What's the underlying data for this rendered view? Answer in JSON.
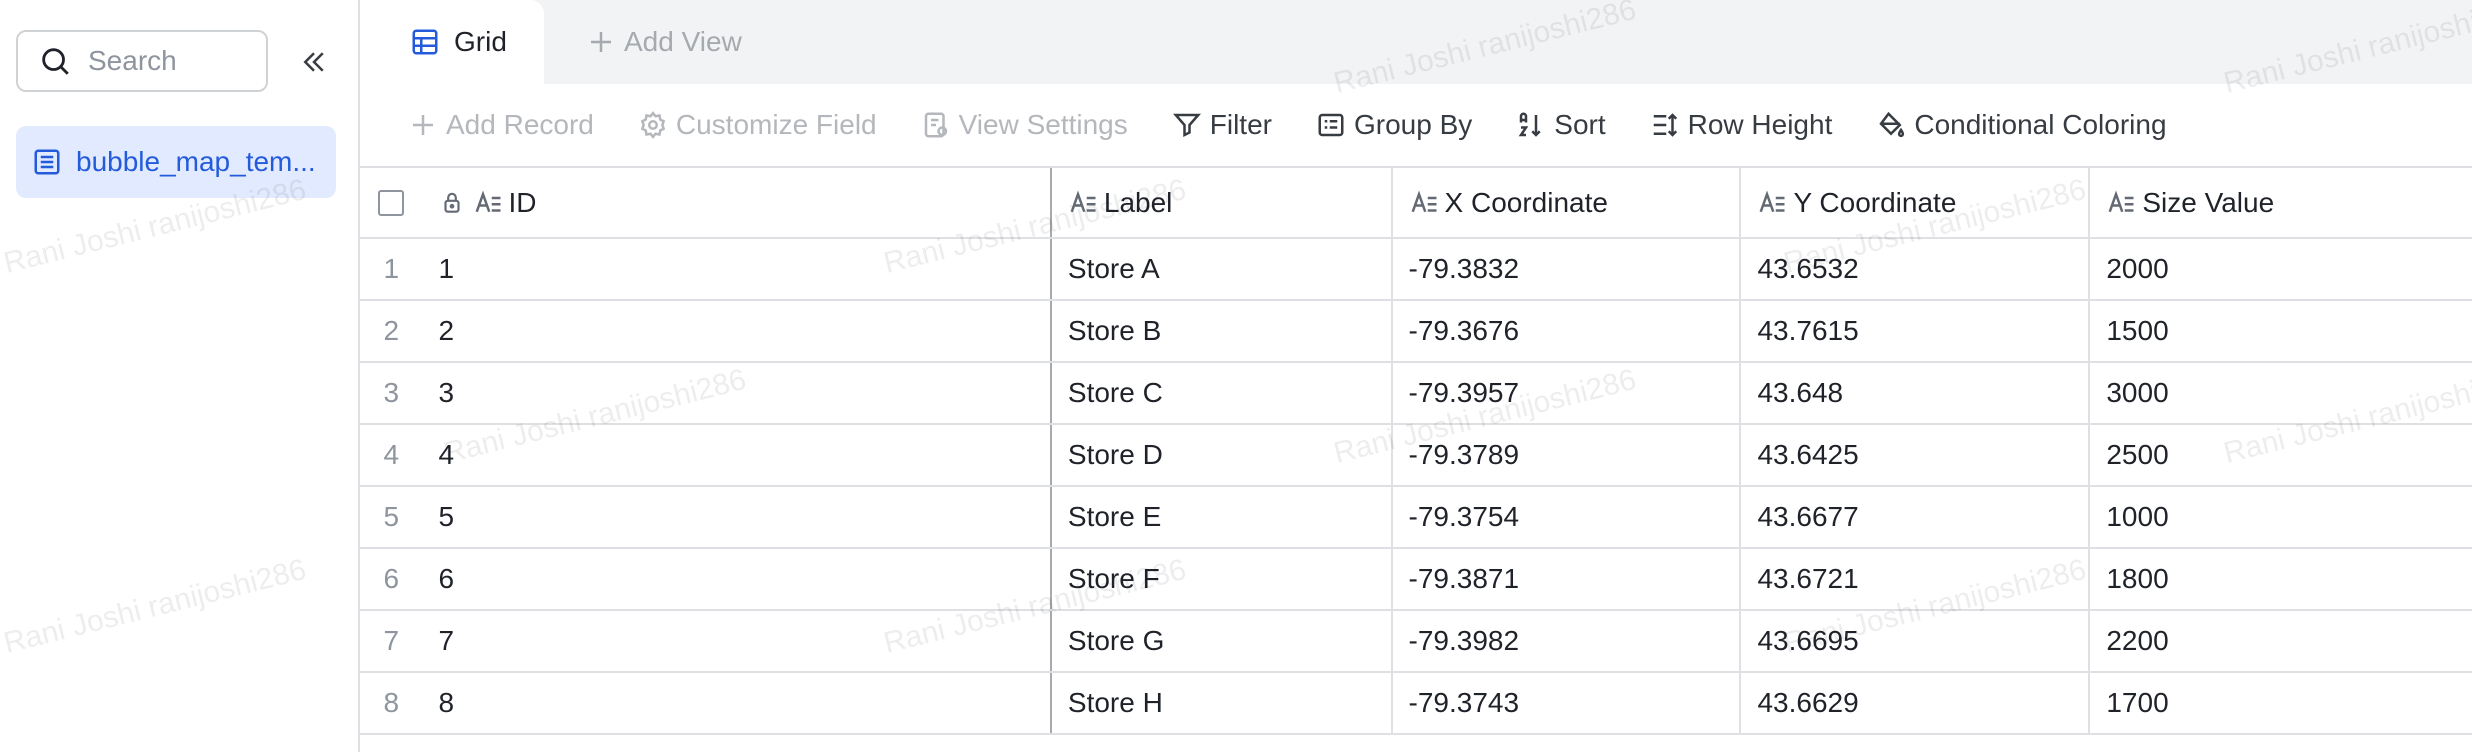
{
  "sidebar": {
    "search_placeholder": "Search",
    "table_name": "bubble_map_tem..."
  },
  "tabs": {
    "grid": "Grid",
    "add_view": "Add View"
  },
  "toolbar": {
    "add_record": "Add Record",
    "customize_field": "Customize Field",
    "view_settings": "View Settings",
    "filter": "Filter",
    "group_by": "Group By",
    "sort": "Sort",
    "row_height": "Row Height",
    "conditional_coloring": "Conditional Coloring"
  },
  "columns": [
    "ID",
    "Label",
    "X Coordinate",
    "Y Coordinate",
    "Size Value"
  ],
  "rows": [
    {
      "num": "1",
      "id": "1",
      "label": "Store A",
      "x": "-79.3832",
      "y": "43.6532",
      "size": "2000"
    },
    {
      "num": "2",
      "id": "2",
      "label": "Store B",
      "x": "-79.3676",
      "y": "43.7615",
      "size": "1500"
    },
    {
      "num": "3",
      "id": "3",
      "label": "Store C",
      "x": "-79.3957",
      "y": "43.648",
      "size": "3000"
    },
    {
      "num": "4",
      "id": "4",
      "label": "Store D",
      "x": "-79.3789",
      "y": "43.6425",
      "size": "2500"
    },
    {
      "num": "5",
      "id": "5",
      "label": "Store E",
      "x": "-79.3754",
      "y": "43.6677",
      "size": "1000"
    },
    {
      "num": "6",
      "id": "6",
      "label": "Store F",
      "x": "-79.3871",
      "y": "43.6721",
      "size": "1800"
    },
    {
      "num": "7",
      "id": "7",
      "label": "Store G",
      "x": "-79.3982",
      "y": "43.6695",
      "size": "2200"
    },
    {
      "num": "8",
      "id": "8",
      "label": "Store H",
      "x": "-79.3743",
      "y": "43.6629",
      "size": "1700"
    }
  ],
  "watermark": "Rani Joshi ranijoshi286",
  "colors": {
    "accent": "#245bdb",
    "accent_bg": "#e1eaff",
    "border": "#dee0e3"
  }
}
